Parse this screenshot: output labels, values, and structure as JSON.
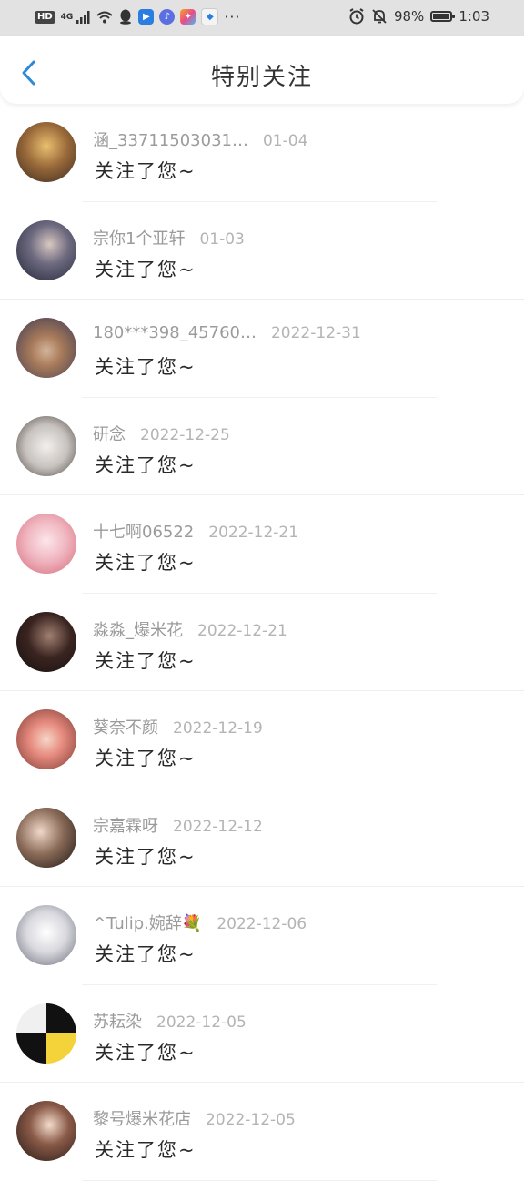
{
  "status_bar": {
    "hd": "HD",
    "network": "4G",
    "battery_percent": "98%",
    "time": "1:03",
    "battery_level": 0.98
  },
  "nav": {
    "title": "特别关注",
    "back_icon": "chevron-left-icon",
    "accent": "#2f88d9"
  },
  "notifications": [
    {
      "name": "涵_33711503031…",
      "date": "01-04",
      "action": "关注了您~"
    },
    {
      "name": "宗你1个亚轩",
      "date": "01-03",
      "action": "关注了您~"
    },
    {
      "name": "180***398_45760…",
      "date": "2022-12-31",
      "action": "关注了您~"
    },
    {
      "name": "研念",
      "date": "2022-12-25",
      "action": "关注了您~"
    },
    {
      "name": "十七啊06522",
      "date": "2022-12-21",
      "action": "关注了您~"
    },
    {
      "name": "淼淼_爆米花",
      "date": "2022-12-21",
      "action": "关注了您~"
    },
    {
      "name": "葵奈不颜",
      "date": "2022-12-19",
      "action": "关注了您~"
    },
    {
      "name": "宗嘉霖呀",
      "date": "2022-12-12",
      "action": "关注了您~"
    },
    {
      "name": "^Tulip.婉辞💐",
      "date": "2022-12-06",
      "action": "关注了您~"
    },
    {
      "name": "苏耘染",
      "date": "2022-12-05",
      "action": "关注了您~"
    },
    {
      "name": "黎号爆米花店",
      "date": "2022-12-05",
      "action": "关注了您~"
    }
  ]
}
